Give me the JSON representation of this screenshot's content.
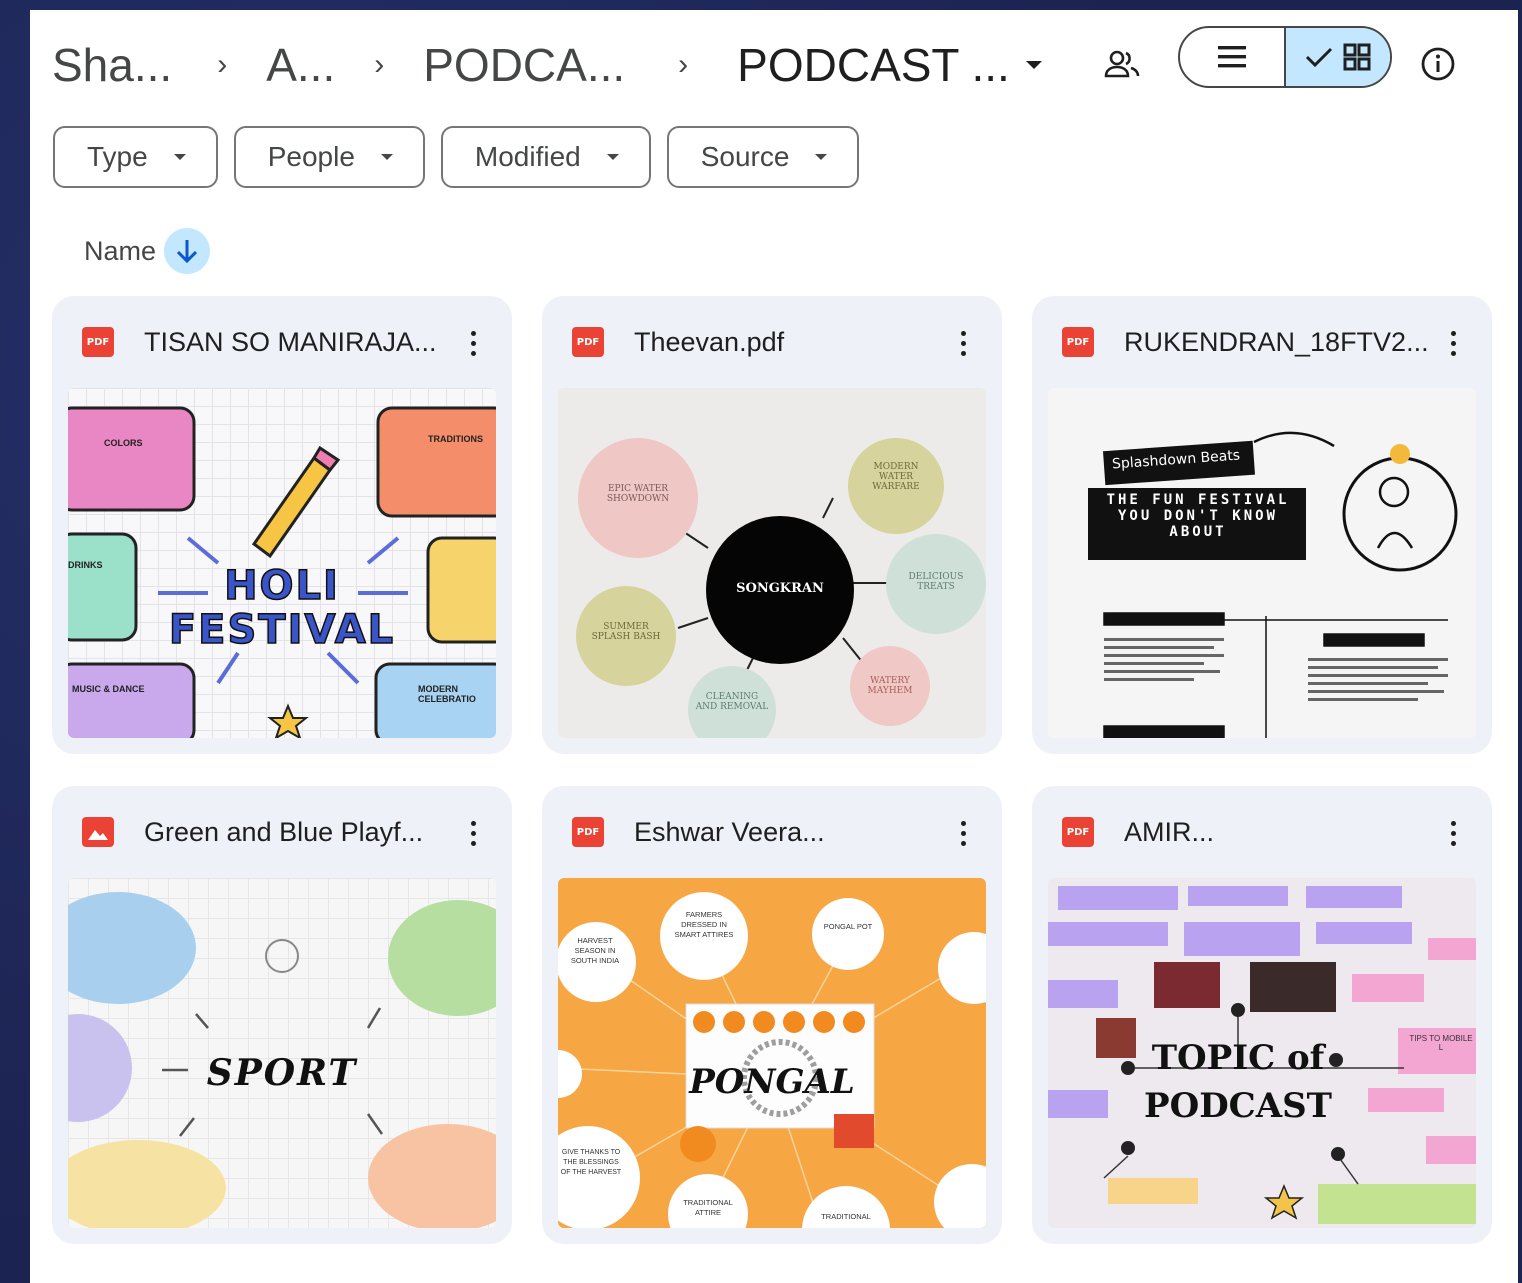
{
  "breadcrumb": {
    "items": [
      "Sha...",
      "A...",
      "PODCA...",
      "PODCAST ..."
    ],
    "separator": "›"
  },
  "header": {
    "share_icon": "people-icon",
    "list_view_icon": "list-icon",
    "grid_view_icon": "grid-icon",
    "info_icon": "info-icon",
    "active_view": "grid"
  },
  "filters": [
    {
      "label": "Type"
    },
    {
      "label": "People"
    },
    {
      "label": "Modified"
    },
    {
      "label": "Source"
    }
  ],
  "sort": {
    "label": "Name",
    "direction": "descending"
  },
  "files": [
    {
      "name": "TISAN SO MANIRAJA...",
      "type_badge": "PDF",
      "thumb": {
        "title_line1": "HOLI",
        "title_line2": "FESTIVAL",
        "labels": [
          "COLORS",
          "TRADITIONS",
          "DRINKS",
          "MUSIC & DANCE",
          "MODERN CELEBRATIO"
        ]
      }
    },
    {
      "name": "Theevan.pdf",
      "type_badge": "PDF",
      "thumb": {
        "center": "SONGKRAN",
        "nodes": [
          "EPIC WATER SHOWDOWN",
          "MODERN WATER WARFARE",
          "DELICIOUS TREATS",
          "WATERY MAYHEM",
          "CLEANING AND REMOVAL",
          "SUMMER SPLASH BASH"
        ]
      }
    },
    {
      "name": "RUKENDRAN_18FTV2...",
      "type_badge": "PDF",
      "thumb": {
        "tag": "Splashdown Beats",
        "headline": "THE FUN FESTIVAL YOU DON'T KNOW ABOUT"
      }
    },
    {
      "name": "Green and Blue Playf...",
      "type_badge": "IMG",
      "thumb": {
        "title": "SPORT"
      }
    },
    {
      "name": "Eshwar Veera...",
      "type_badge": "PDF",
      "thumb": {
        "title": "PONGAL",
        "nodes": [
          "HARVEST SEASON IN SOUTH INDIA",
          "FARMERS DRESSED IN SMART ATTIRES",
          "PONGAL POT",
          "GIVE THANKS TO THE BLESSINGS OF THE HARVEST",
          "TRADITIONAL ATTIRE",
          "TRADITIONAL"
        ]
      }
    },
    {
      "name": "AMIR...",
      "type_badge": "PDF",
      "thumb": {
        "title_line1": "TOPIC of",
        "title_line2": "PODCAST",
        "side": "TIPS TO MOBILE L"
      }
    }
  ],
  "colors": {
    "background": "#1b2350",
    "panel": "#ffffff",
    "card": "#eef1f8",
    "selected_toggle": "#c2e7ff",
    "pdf_badge": "#ea4335"
  }
}
